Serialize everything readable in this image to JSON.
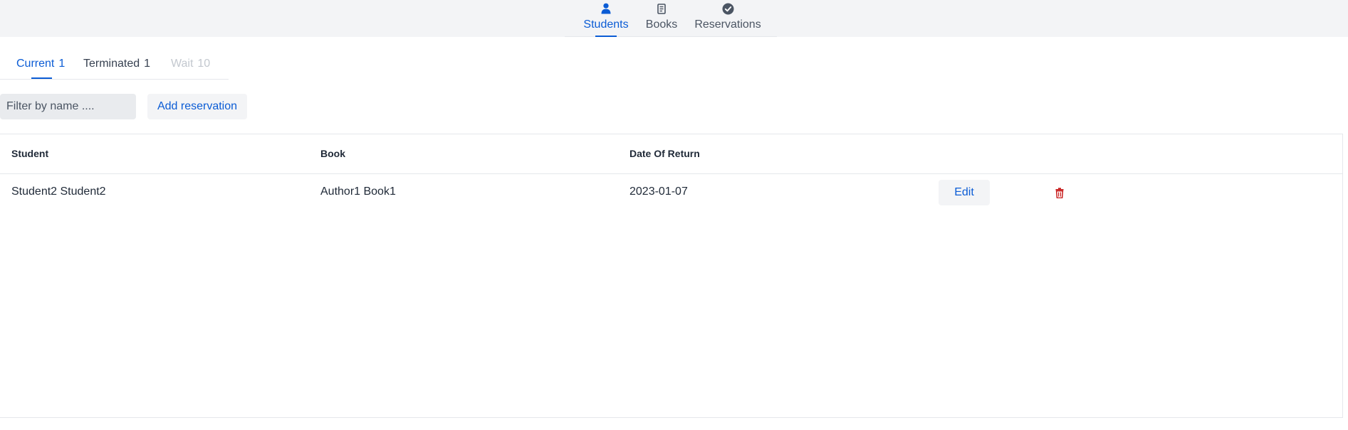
{
  "nav": {
    "items": [
      {
        "label": "Students",
        "icon": "person-icon",
        "active": true
      },
      {
        "label": "Books",
        "icon": "book-icon",
        "active": false
      },
      {
        "label": "Reservations",
        "icon": "check-circle-icon",
        "active": false
      }
    ]
  },
  "tabs": [
    {
      "label": "Current",
      "count": "1",
      "active": true
    },
    {
      "label": "Terminated",
      "count": "1",
      "active": false
    },
    {
      "label": "Wait",
      "count": "10",
      "active": false,
      "disabled": true
    }
  ],
  "toolbar": {
    "filter_placeholder": "Filter by name ....",
    "filter_value": "",
    "add_label": "Add reservation"
  },
  "table": {
    "columns": [
      "Student",
      "Book",
      "Date Of Return"
    ],
    "rows": [
      {
        "student": "Student2 Student2",
        "book": "Author1 Book1",
        "date": "2023-01-07",
        "edit_label": "Edit",
        "delete_icon": "trash-icon"
      }
    ]
  },
  "colors": {
    "accent": "#0b5cd5",
    "danger": "#c81e1e",
    "nav_bg": "#f3f4f6",
    "muted": "#c3c8cf"
  }
}
